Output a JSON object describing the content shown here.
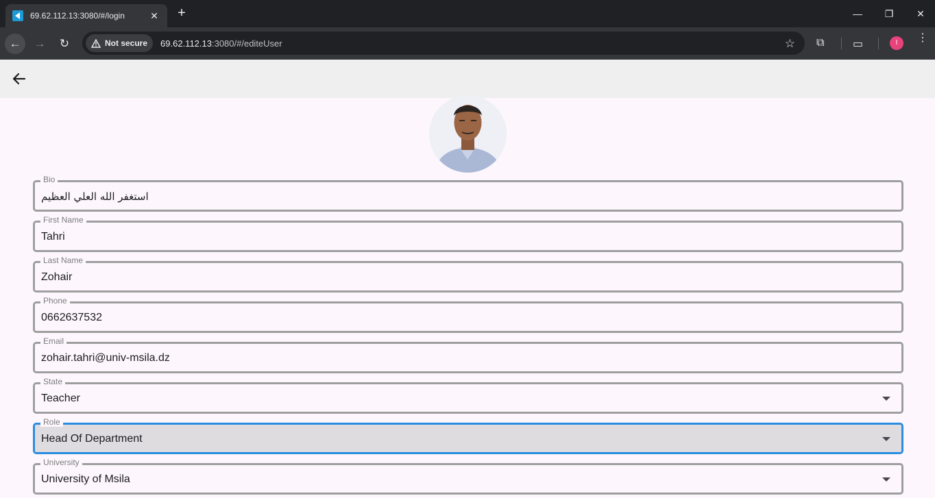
{
  "browser": {
    "tab_title": "69.62.112.13:3080/#/login",
    "security_label": "Not secure",
    "url_host": "69.62.112.13",
    "url_rest": ":3080/#/editeUser",
    "profile_initial": "I"
  },
  "form": {
    "bio": {
      "label": "Bio",
      "value": "استغفر الله العلي العظيم"
    },
    "first_name": {
      "label": "First Name",
      "value": "Tahri"
    },
    "last_name": {
      "label": "Last Name",
      "value": "Zohair"
    },
    "phone": {
      "label": "Phone",
      "value": "0662637532"
    },
    "email": {
      "label": "Email",
      "value": "zohair.tahri@univ-msila.dz"
    },
    "state": {
      "label": "State",
      "value": "Teacher"
    },
    "role": {
      "label": "Role",
      "value": "Head Of Department"
    },
    "university": {
      "label": "University",
      "value": "University of Msila"
    }
  },
  "colors": {
    "focus_border": "#2a8de0",
    "profile_badge": "#e8437a"
  }
}
